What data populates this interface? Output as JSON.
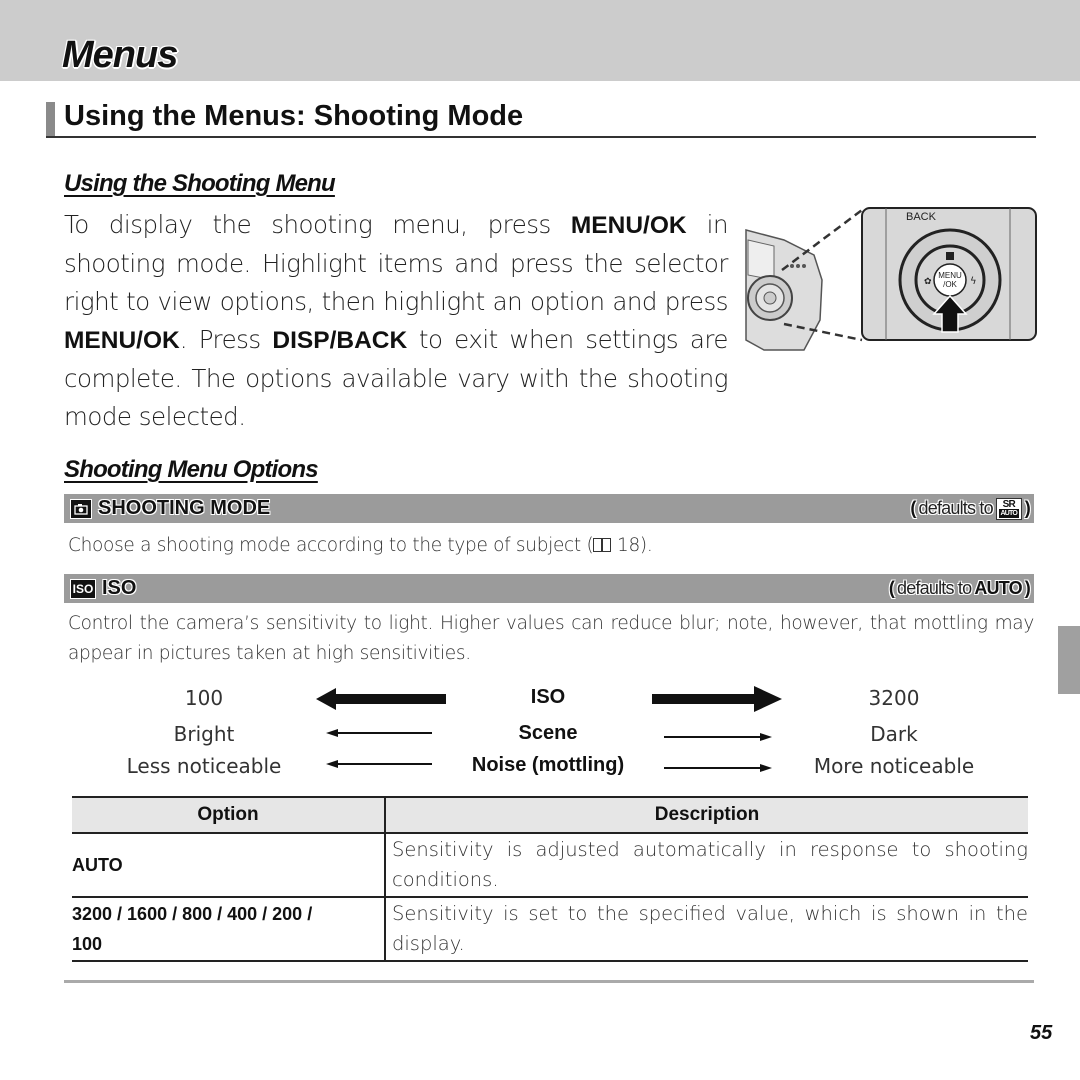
{
  "header": {
    "chapter_title": "Menus"
  },
  "section": {
    "title": "Using the Menus: Shooting Mode"
  },
  "using_menu": {
    "title": "Using the Shooting Menu",
    "text_1": "To display the shooting menu, press ",
    "key_menu_ok": "MENU/OK",
    "text_2": " in shooting mode. Highlight items and press the selector right to view options, then highlight an option and press ",
    "key_menu_ok_2": "MENU/OK",
    "text_3": ". Press ",
    "key_disp_back": "DISP/BACK",
    "text_4": " to exit when settings are complete. The options available vary with the shooting mode selected."
  },
  "illustration": {
    "back_label": "BACK",
    "menu_label": "MENU",
    "ok_label": "/OK"
  },
  "options_section": {
    "title": "Shooting Menu Options",
    "items": [
      {
        "icon": "camera-icon",
        "label": "SHOOTING MODE",
        "defaults_prefix": "defaults to",
        "defaults_badge_top": "SR",
        "defaults_badge_bottom": "AUTO",
        "description": "Choose a shooting mode according to the type of subject (",
        "page_ref_icon": "book-icon",
        "page_ref": " 18)."
      },
      {
        "icon": "iso-icon",
        "icon_text": "ISO",
        "label": "ISO",
        "defaults_prefix": "defaults to",
        "defaults_value": "AUTO",
        "description": "Control the camera’s sensitivity to light. Higher values can reduce blur; note, however, that mottling may appear in pictures taken at high sensitivities."
      }
    ]
  },
  "iso_scale": {
    "rows": [
      {
        "left": "100",
        "center": "ISO",
        "right": "3200"
      },
      {
        "left": "Bright",
        "center": "Scene",
        "right": "Dark"
      },
      {
        "left": "Less noticeable",
        "center": "Noise (mottling)",
        "right": "More noticeable"
      }
    ]
  },
  "iso_table": {
    "headers": [
      "Option",
      "Description"
    ],
    "rows": [
      {
        "option": "AUTO",
        "description": "Sensitivity is adjusted automatically in response to shooting conditions."
      },
      {
        "option": "3200 / 1600 / 800 / 400 / 200 / 100",
        "description": "Sensitivity is set to the specified value, which is shown in the display."
      }
    ]
  },
  "footer": {
    "page_number": "55"
  }
}
